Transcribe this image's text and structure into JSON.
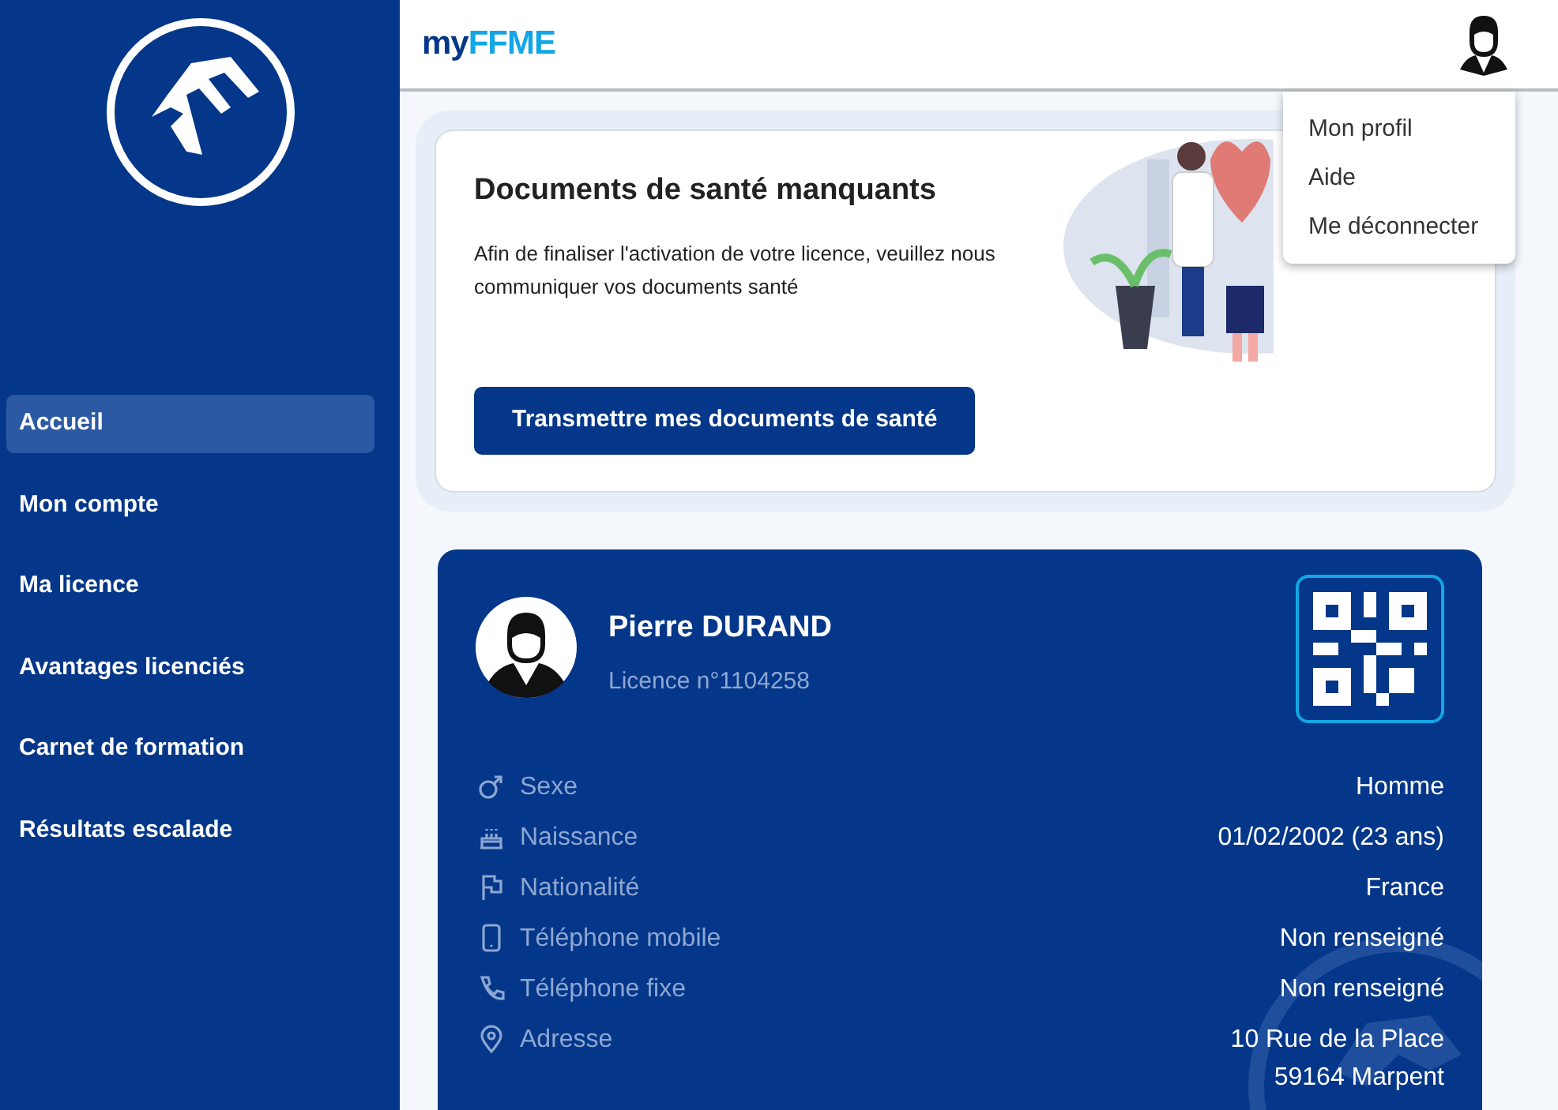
{
  "sidebar": {
    "items": [
      {
        "label": "Accueil",
        "selected": true
      },
      {
        "label": "Mon compte",
        "selected": false
      },
      {
        "label": "Ma licence",
        "selected": false
      },
      {
        "label": "Avantages licenciés",
        "selected": false
      },
      {
        "label": "Carnet de formation",
        "selected": false
      },
      {
        "label": "Résultats escalade",
        "selected": false
      }
    ]
  },
  "header": {
    "logo_prefix": "my",
    "logo_name": "FFME"
  },
  "user_menu": {
    "expanded": true,
    "items": [
      "Mon profil",
      "Aide",
      "Me déconnecter"
    ]
  },
  "health_alert": {
    "title": "Documents de santé manquants",
    "text": "Afin de finaliser l'activation de votre licence, veuillez nous communiquer vos documents santé",
    "button": "Transmettre mes documents de santé"
  },
  "profile": {
    "name": "Pierre DURAND",
    "licence": "Licence n°1104258",
    "fields": [
      {
        "label": "Sexe",
        "value": [
          "Homme"
        ]
      },
      {
        "label": "Naissance",
        "value": [
          "01/02/2002 (23 ans)"
        ]
      },
      {
        "label": "Nationalité",
        "value": [
          "France"
        ]
      },
      {
        "label": "Téléphone mobile",
        "value": [
          "Non renseigné"
        ]
      },
      {
        "label": "Téléphone fixe",
        "value": [
          "Non renseigné"
        ]
      },
      {
        "label": "Adresse",
        "value": [
          "10 Rue de la Place",
          "59164 Marpent"
        ]
      }
    ]
  }
}
